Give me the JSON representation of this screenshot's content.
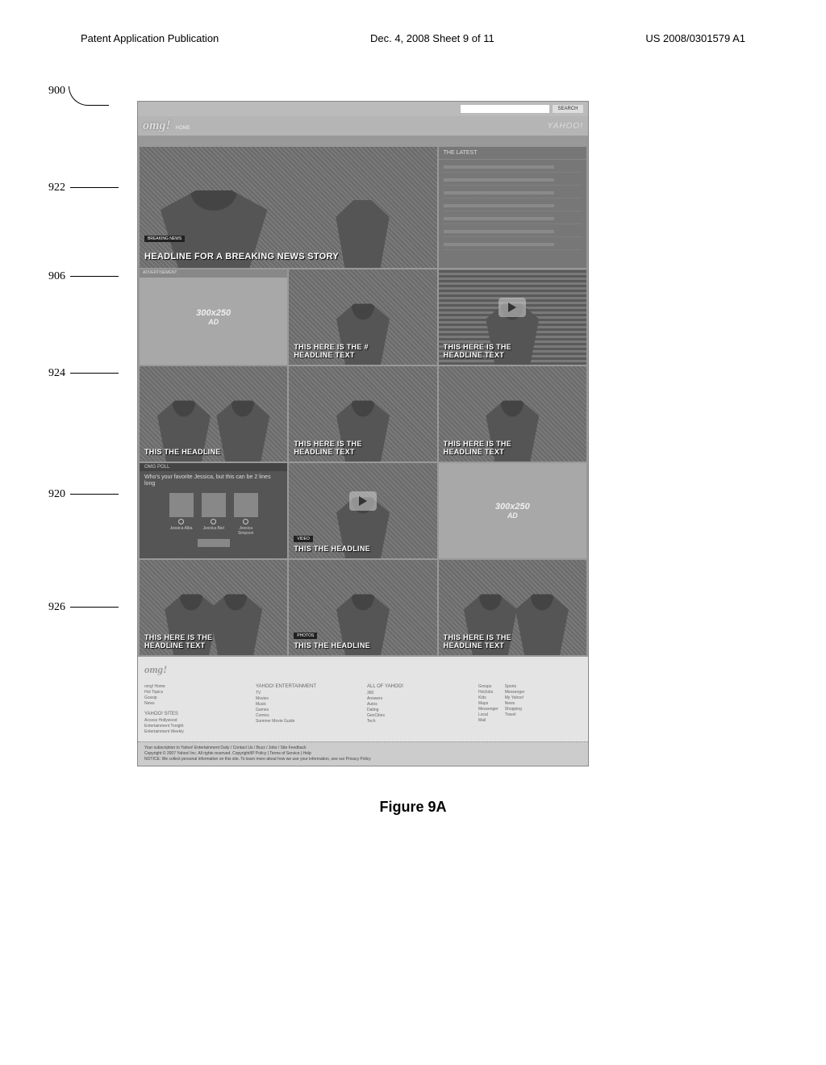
{
  "header": {
    "left": "Patent Application Publication",
    "center": "Dec. 4, 2008  Sheet 9 of 11",
    "right": "US 2008/0301579 A1"
  },
  "callouts": {
    "n900": "900",
    "n906": "906",
    "n920": "920",
    "n922": "922",
    "n924": "924",
    "n926": "926"
  },
  "topbar": {
    "search_btn": "SEARCH"
  },
  "logo": {
    "main": "omg!",
    "home": "HOME",
    "partner": "YAHOO!"
  },
  "tiles": {
    "hero_tag": "BREAKING NEWS",
    "hero_headline": "HEADLINE FOR A BREAKING NEWS STORY",
    "latest_label": "THE LATEST",
    "ad_label": "ADVERTISEMENT",
    "ad_size": "300x250",
    "ad_sub": "AD",
    "r2c2": "THIS HERE IS THE #\nHEADLINE TEXT",
    "r2c3": "THIS HERE IS THE\nHEADLINE TEXT",
    "r3c1": "THIS THE HEADLINE",
    "r3c2": "THIS HERE IS THE\nHEADLINE TEXT",
    "r3c3": "THIS HERE IS THE\nHEADLINE TEXT",
    "poll_head": "OMG POLL",
    "poll_q": "Who's your favorite Jessica, but this can be 2 lines long",
    "poll_opt1": "Jessica Alba",
    "poll_opt2": "Jessica Biel",
    "poll_opt3": "Jessica Simpson",
    "r4c2_tag": "VIDEO",
    "r4c2": "THIS THE HEADLINE",
    "r5c1": "THIS HERE IS THE\nHEADLINE TEXT",
    "r5c2_tag": "PHOTOS",
    "r5c2": "THIS THE HEADLINE",
    "r5c3": "THIS HERE IS THE\nHEADLINE TEXT"
  },
  "footer": {
    "logo": "omg!",
    "col1_h": "",
    "col1": [
      "omg! Home",
      "Hot Topics",
      "Gossip",
      "News"
    ],
    "col2_h": "YAHOO! SITES",
    "col2": [
      "Access Hollywood",
      "Entertainment Tonight",
      "Entertainment Weekly"
    ],
    "col3_h": "YAHOO! ENTERTAINMENT",
    "col3": [
      "TV",
      "Movies",
      "Music",
      "Games",
      "Comics",
      "Summer Movie Guide"
    ],
    "col4_h": "ALL OF YAHOO!",
    "col4a": [
      "360",
      "Answers",
      "Autos",
      "Dating",
      "GeoCities",
      "Tech"
    ],
    "col4b": [
      "Groups",
      "HotJobs",
      "Kids",
      "Maps",
      "Messenger",
      "Local",
      "Mail"
    ],
    "col4c": [
      "Sports",
      "Messenger",
      "My Yahoo!",
      "News",
      "Shopping",
      "Travel"
    ],
    "note1": "Your subscription to Yahoo! Entertainment Daily / Contact Us / Buzz / Jobs / Site Feedback",
    "note2": "Copyright © 2007 Yahoo! Inc. All rights reserved.  Copyright/IP Policy | Terms of Service | Help",
    "note3": "NOTICE: We collect personal information on this site. To learn more about how we use your information, see our Privacy Policy"
  },
  "caption": "Figure 9A"
}
